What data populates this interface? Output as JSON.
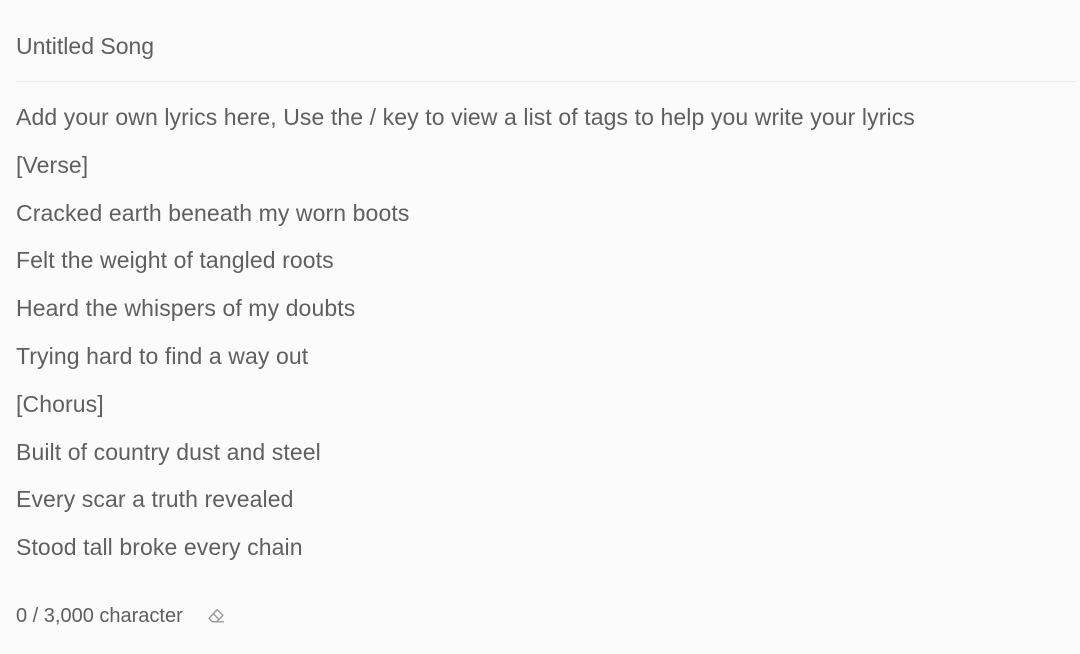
{
  "song": {
    "title": "Untitled Song"
  },
  "lyrics": {
    "lines": [
      "Add your own lyrics here, Use the / key to view a list of tags to help you write your lyrics",
      "[Verse]",
      "Cracked earth beneath my worn boots",
      "Felt the weight of tangled roots",
      "Heard the whispers of my doubts",
      "Trying hard to find a way out",
      "[Chorus]",
      "Built of country dust and steel",
      "Every scar a truth revealed",
      "Stood tall broke every chain"
    ]
  },
  "footer": {
    "char_count": "0 / 3,000 character",
    "clear_icon": "eraser-icon"
  },
  "colors": {
    "background": "#fbfbfb",
    "text": "#5f5f5f",
    "divider": "#ececec",
    "icon": "#9a9a9a"
  }
}
